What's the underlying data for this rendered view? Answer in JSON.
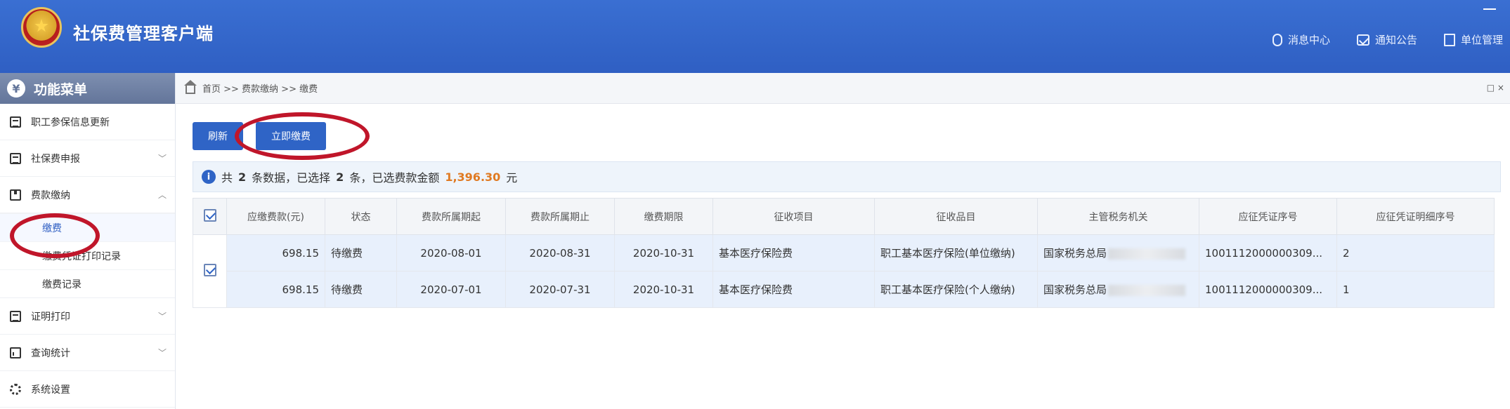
{
  "app": {
    "title": "社保费管理客户端",
    "header_links": [
      "消息中心",
      "通知公告",
      "单位管理"
    ]
  },
  "sidebar": {
    "title": "功能菜单",
    "items": [
      {
        "label": "职工参保信息更新"
      },
      {
        "label": "社保费申报"
      },
      {
        "label": "费款缴纳"
      },
      {
        "label": "证明打印"
      },
      {
        "label": "查询统计"
      },
      {
        "label": "系统设置"
      }
    ],
    "subitems": [
      {
        "label": "缴费"
      },
      {
        "label": "缴费凭证打印记录"
      },
      {
        "label": "缴费记录"
      }
    ]
  },
  "breadcrumb": {
    "text": "首页 >> 费款缴纳 >> 缴费",
    "right": "□ ×"
  },
  "toolbar": {
    "refresh_label": "刷新",
    "pay_now_label": "立即缴费"
  },
  "summary": {
    "prefix": "共",
    "total": "2",
    "mid1": "条数据，已选择",
    "selected": "2",
    "mid2": "条，已选费款金额",
    "amount": "1,396.30",
    "suffix": "元"
  },
  "table": {
    "headers": [
      "应缴费款(元)",
      "状态",
      "费款所属期起",
      "费款所属期止",
      "缴费期限",
      "征收项目",
      "征收品目",
      "主管税务机关",
      "应征凭证序号",
      "应征凭证明细序号"
    ],
    "rows": [
      [
        "698.15",
        "待缴费",
        "2020-08-01",
        "2020-08-31",
        "2020-10-31",
        "基本医疗保险费",
        "职工基本医疗保险(单位缴纳)",
        "国家税务总局",
        "1001112000000309...",
        "2"
      ],
      [
        "698.15",
        "待缴费",
        "2020-07-01",
        "2020-07-31",
        "2020-10-31",
        "基本医疗保险费",
        "职工基本医疗保险(个人缴纳)",
        "国家税务总局",
        "1001112000000309...",
        "1"
      ]
    ]
  },
  "colors": {
    "header_blue": "#2f5fc3",
    "button_blue": "#2f64c6",
    "amount_orange": "#e07a22",
    "annotation_red": "#c0162a"
  }
}
